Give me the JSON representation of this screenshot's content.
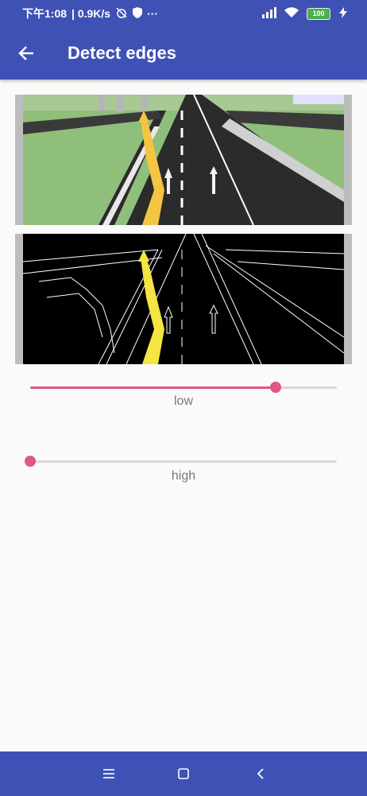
{
  "status_bar": {
    "time": "下午1:08",
    "network_speed": "| 0.9K/s",
    "more_dots": "···",
    "battery_level": "100"
  },
  "app_bar": {
    "title": "Detect edges"
  },
  "images": {
    "original": "road-scene-image",
    "edges": "edge-detection-image"
  },
  "sliders": {
    "low": {
      "label": "low",
      "value_fraction": 0.8
    },
    "high": {
      "label": "high",
      "value_fraction": 0.0
    }
  },
  "colors": {
    "primary": "#3f51b5",
    "accent": "#e05685",
    "background": "#fafafa"
  },
  "nav_bar": {
    "icons": [
      "menu-icon",
      "home-icon",
      "back-icon"
    ]
  }
}
